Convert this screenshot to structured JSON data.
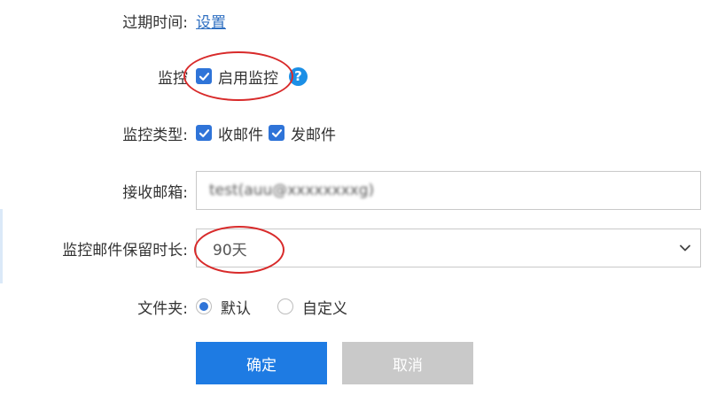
{
  "form": {
    "expiry": {
      "label": "过期时间:",
      "link": "设置"
    },
    "monitor": {
      "label": "监控",
      "checkbox_label": "启用监控",
      "checked": true,
      "help_icon": "question-icon"
    },
    "monitor_type": {
      "label": "监控类型:",
      "options": [
        {
          "label": "收邮件",
          "checked": true
        },
        {
          "label": "发邮件",
          "checked": true
        }
      ]
    },
    "receive_mailbox": {
      "label": "接收邮箱:",
      "value": "test(auu@xxxxxxxxg)"
    },
    "retention": {
      "label": "监控邮件保留时长:",
      "selected": "90天"
    },
    "folder": {
      "label": "文件夹:",
      "options": [
        {
          "label": "默认",
          "selected": true
        },
        {
          "label": "自定义",
          "selected": false
        }
      ]
    }
  },
  "buttons": {
    "confirm": "确定",
    "cancel": "取消"
  },
  "colors": {
    "primary": "#1e7be3",
    "checkbox": "#2f74d8",
    "link": "#2f6fc1",
    "disabled": "#c9c9c9",
    "annotation": "#d82a2a",
    "help": "#1b8fe6"
  }
}
